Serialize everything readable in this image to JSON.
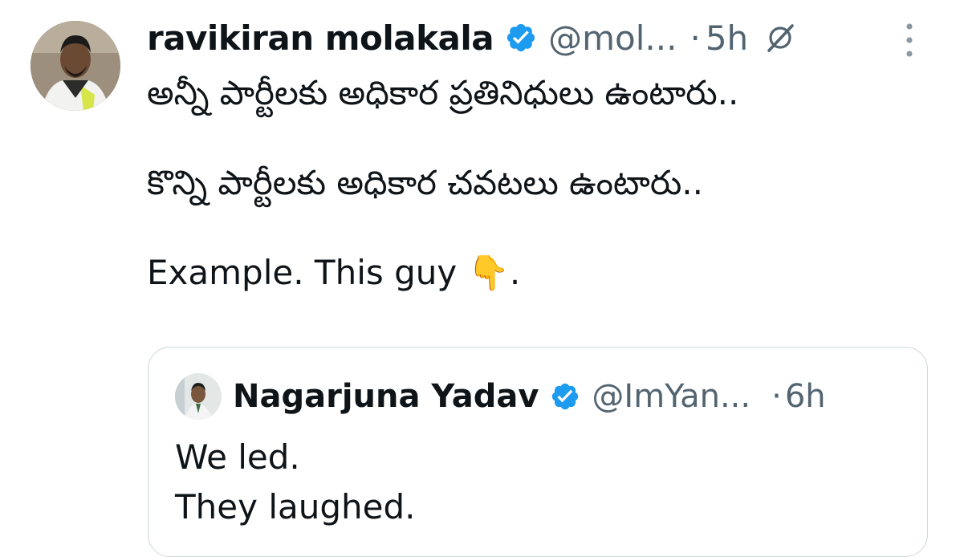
{
  "tweet": {
    "author_name": "ravikiran molakala",
    "handle": "@mol...",
    "separator": "·",
    "time": "5h",
    "text": "అన్నీ పార్టీలకు అధికార ప్రతినిధులు ఉంటారు..\n\nకొన్ని పార్టీలకు అధికార చవటలు ఉంటారు..\n\nExample. This guy 👇.",
    "verified_color": "#1d9bf0"
  },
  "quoted_tweet": {
    "author_name": "Nagarjuna Yadav",
    "handle": "@ImYan...",
    "separator": "·",
    "time": "6h",
    "text": "We led.\nThey laughed."
  },
  "icons": {
    "verified": "verified-badge-icon",
    "grok": "grok-icon",
    "more": "more-options-icon"
  }
}
